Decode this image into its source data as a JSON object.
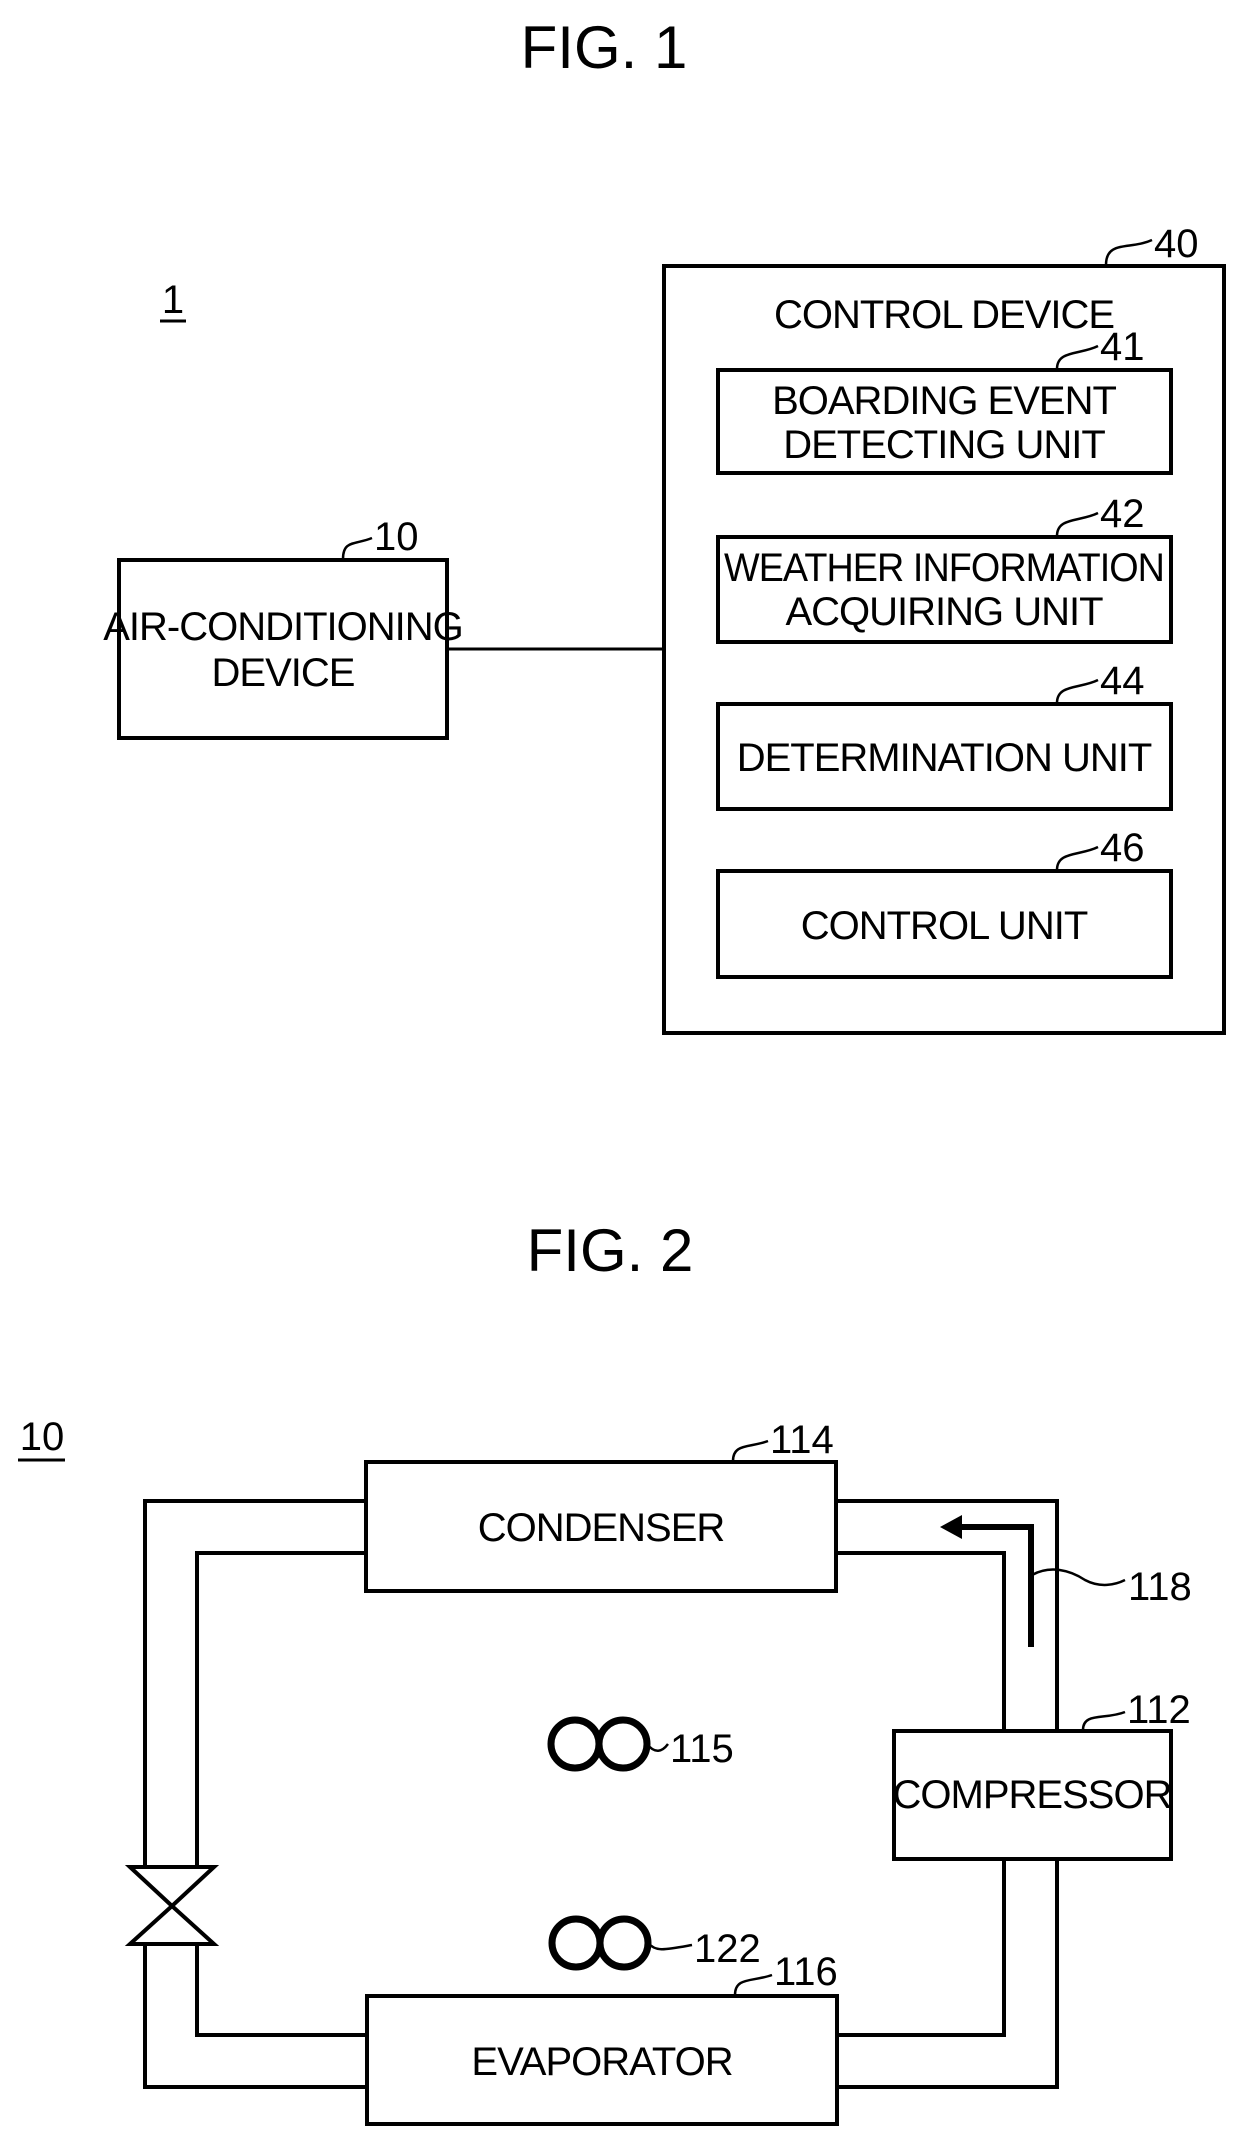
{
  "figures": [
    {
      "title": "FIG. 1",
      "system_ref": "1",
      "air_conditioning_device": {
        "ref": "10",
        "label_lines": [
          "AIR-CONDITIONING",
          "DEVICE"
        ]
      },
      "control_device": {
        "ref": "40",
        "label": "CONTROL DEVICE",
        "units": [
          {
            "ref": "41",
            "label_lines": [
              "BOARDING EVENT",
              "DETECTING UNIT"
            ]
          },
          {
            "ref": "42",
            "label_lines": [
              "WEATHER INFORMATION",
              "ACQUIRING UNIT"
            ]
          },
          {
            "ref": "44",
            "label_lines": [
              "DETERMINATION UNIT"
            ]
          },
          {
            "ref": "46",
            "label_lines": [
              "CONTROL UNIT"
            ]
          }
        ]
      }
    },
    {
      "title": "FIG. 2",
      "system_ref": "10",
      "condenser": {
        "ref": "114",
        "label": "CONDENSER"
      },
      "condenser_fan": {
        "ref": "115"
      },
      "refrigerant_pipe": {
        "ref": "118"
      },
      "compressor": {
        "ref": "112",
        "label": "COMPRESSOR"
      },
      "evaporator_fan": {
        "ref": "122"
      },
      "evaporator": {
        "ref": "116",
        "label": "EVAPORATOR"
      },
      "expansion_valve": {
        "icon": "valve-icon"
      }
    }
  ]
}
